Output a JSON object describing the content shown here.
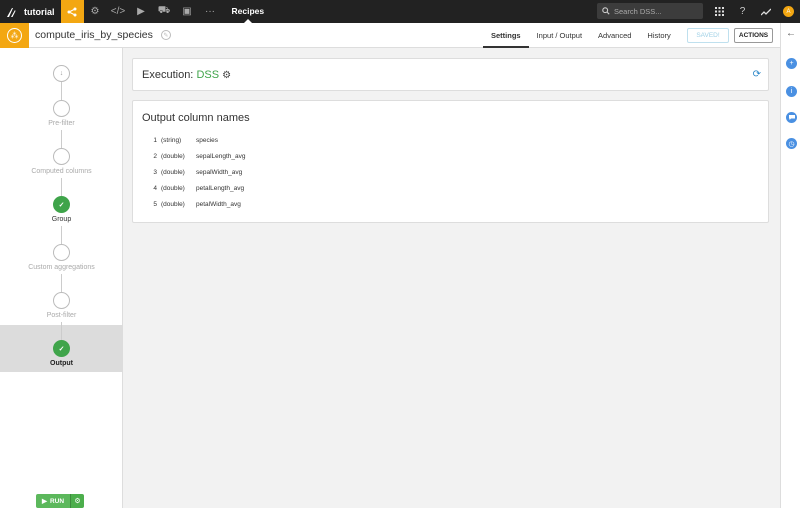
{
  "topbar": {
    "project_name": "tutorial",
    "section": "Recipes",
    "search_placeholder": "Search DSS...",
    "avatar_initial": "A",
    "nav_icons": [
      "flow-icon",
      "settings-icon",
      "code-icon",
      "run-icon",
      "bundle-icon",
      "dashboard-icon",
      "more-icon"
    ],
    "right_icons": [
      "apps-grid-icon",
      "help-icon",
      "activity-icon"
    ]
  },
  "recipe": {
    "name": "compute_iris_by_species",
    "tabs": [
      "Settings",
      "Input / Output",
      "Advanced",
      "History"
    ],
    "active_tab": "Settings",
    "saved_label": "SAVED!",
    "actions_label": "ACTIONS"
  },
  "steps": [
    {
      "label": "",
      "state": "start",
      "glyph": "↓"
    },
    {
      "label": "Pre-filter",
      "state": "pending"
    },
    {
      "label": "Computed columns",
      "state": "pending"
    },
    {
      "label": "Group",
      "state": "done"
    },
    {
      "label": "Custom aggregations",
      "state": "pending"
    },
    {
      "label": "Post-filter",
      "state": "pending"
    },
    {
      "label": "Output",
      "state": "active"
    }
  ],
  "run": {
    "label": "RUN"
  },
  "execution": {
    "label": "Execution:",
    "engine": "DSS"
  },
  "output": {
    "title": "Output column names",
    "columns": [
      {
        "num": "1",
        "type": "(string)",
        "name": "species"
      },
      {
        "num": "2",
        "type": "(double)",
        "name": "sepalLength_avg"
      },
      {
        "num": "3",
        "type": "(double)",
        "name": "sepalWidth_avg"
      },
      {
        "num": "4",
        "type": "(double)",
        "name": "petalLength_avg"
      },
      {
        "num": "5",
        "type": "(double)",
        "name": "petalWidth_avg"
      }
    ]
  },
  "colors": {
    "accent": "#f3a712",
    "success": "#3fa44a",
    "link": "#2a86c8"
  }
}
